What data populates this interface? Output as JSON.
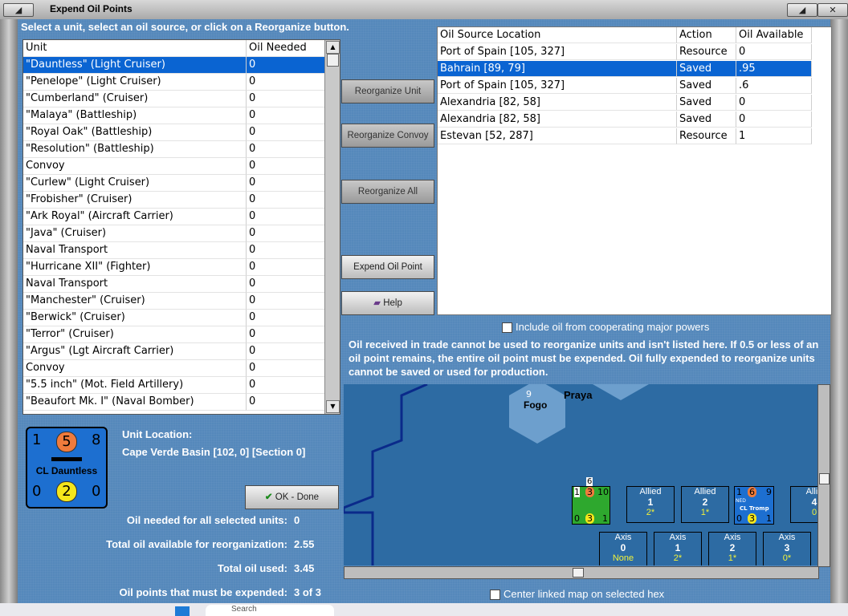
{
  "window": {
    "title": "Expend Oil Points",
    "close_glyph": "✕"
  },
  "instruction": "Select a unit, select an oil source, or click on a Reorganize button.",
  "unit_table": {
    "headers": [
      "Unit",
      "Oil Needed"
    ],
    "rows": [
      {
        "unit": "\"Dauntless\" (Light Cruiser)",
        "oil": "0"
      },
      {
        "unit": "\"Penelope\" (Light Cruiser)",
        "oil": "0"
      },
      {
        "unit": "\"Cumberland\" (Cruiser)",
        "oil": "0"
      },
      {
        "unit": "\"Malaya\" (Battleship)",
        "oil": "0"
      },
      {
        "unit": "\"Royal Oak\" (Battleship)",
        "oil": "0"
      },
      {
        "unit": "\"Resolution\" (Battleship)",
        "oil": "0"
      },
      {
        "unit": "Convoy",
        "oil": "0"
      },
      {
        "unit": "\"Curlew\" (Light Cruiser)",
        "oil": "0"
      },
      {
        "unit": "\"Frobisher\" (Cruiser)",
        "oil": "0"
      },
      {
        "unit": "\"Ark Royal\" (Aircraft Carrier)",
        "oil": "0"
      },
      {
        "unit": "\"Java\" (Cruiser)",
        "oil": "0"
      },
      {
        "unit": "Naval Transport",
        "oil": "0"
      },
      {
        "unit": "\"Hurricane XII\" (Fighter)",
        "oil": "0"
      },
      {
        "unit": "Naval Transport",
        "oil": "0"
      },
      {
        "unit": "\"Manchester\" (Cruiser)",
        "oil": "0"
      },
      {
        "unit": "\"Berwick\" (Cruiser)",
        "oil": "0"
      },
      {
        "unit": "\"Terror\" (Cruiser)",
        "oil": "0"
      },
      {
        "unit": "\"Argus\" (Lgt Aircraft Carrier)",
        "oil": "0"
      },
      {
        "unit": "Convoy",
        "oil": "0"
      },
      {
        "unit": "\"5.5 inch\" (Mot. Field Artillery)",
        "oil": "0"
      },
      {
        "unit": "\"Beaufort Mk. I\" (Naval Bomber)",
        "oil": "0"
      }
    ]
  },
  "buttons": {
    "reorganize_unit": "Reorganize Unit",
    "reorganize_convoy": "Reorganize Convoy",
    "reorganize_all": "Reorganize All",
    "expend_oil_point": "Expend Oil Point",
    "help": "Help",
    "ok_done": "OK - Done"
  },
  "oil_table": {
    "headers": [
      "Oil Source Location",
      "Action",
      "Oil Available"
    ],
    "rows": [
      {
        "loc": "Port of Spain [105, 327]",
        "action": "Resource",
        "avail": "0"
      },
      {
        "loc": "Bahrain [89, 79]",
        "action": "Saved",
        "avail": ".95"
      },
      {
        "loc": "Port of Spain [105, 327]",
        "action": "Saved",
        "avail": ".6"
      },
      {
        "loc": "Alexandria [82, 58]",
        "action": "Saved",
        "avail": "0"
      },
      {
        "loc": "Alexandria [82, 58]",
        "action": "Saved",
        "avail": "0"
      },
      {
        "loc": "Estevan [52, 287]",
        "action": "Resource",
        "avail": "1"
      }
    ]
  },
  "include_coop_label": "Include oil from cooperating major powers",
  "note": "Oil received in trade cannot be used to reorganize units and isn't listed here.  If 0.5 or less of an oil point remains, the entire oil point must be expended.   Oil fully expended to reorganize units cannot be saved or used for production.",
  "unit_counter": {
    "top_left": "1",
    "top_mid": "5",
    "top_right": "8",
    "name": "CL Dauntless",
    "bot_left": "0",
    "bot_mid": "2",
    "bot_right": "0"
  },
  "unit_location": {
    "label": "Unit Location:",
    "value": "Cape Verde Basin [102, 0] [Section 0]"
  },
  "stats": {
    "oil_needed_label": "Oil needed for all selected units:",
    "oil_needed_value": "0",
    "total_avail_label": "Total oil available for reorganization:",
    "total_avail_value": "2.55",
    "total_used_label": "Total oil used:",
    "total_used_value": "3.45",
    "must_expend_label": "Oil points that must be expended:",
    "must_expend_value": "3 of 3"
  },
  "map": {
    "places": [
      "Praya",
      "Fogo"
    ],
    "fogo_marker": "9",
    "stack_count": "6",
    "allied_slots": [
      {
        "label": "Allied",
        "value": "1",
        "sub": "2*"
      },
      {
        "label": "Allied",
        "value": "2",
        "sub": "1*"
      },
      {
        "label": "Allie",
        "value": "4",
        "sub": "0"
      }
    ],
    "axis_slots": [
      {
        "label": "Axis",
        "value": "0",
        "sub": "None"
      },
      {
        "label": "Axis",
        "value": "1",
        "sub": "2*"
      },
      {
        "label": "Axis",
        "value": "2",
        "sub": "1*"
      },
      {
        "label": "Axis",
        "value": "3",
        "sub": "0*"
      }
    ],
    "green_counter": {
      "tl": "1",
      "tm": "3",
      "tr": "10",
      "bl": "0",
      "bm": "3",
      "br": "1"
    },
    "blue_counter": {
      "tl": "1",
      "tm": "6",
      "tr": "9",
      "flag": "NED",
      "name": "CL Tromp",
      "bl": "0",
      "bm": "3",
      "br": "1"
    }
  },
  "center_linked_label": "Center linked map on selected hex",
  "taskbar": {
    "search": "Search"
  }
}
